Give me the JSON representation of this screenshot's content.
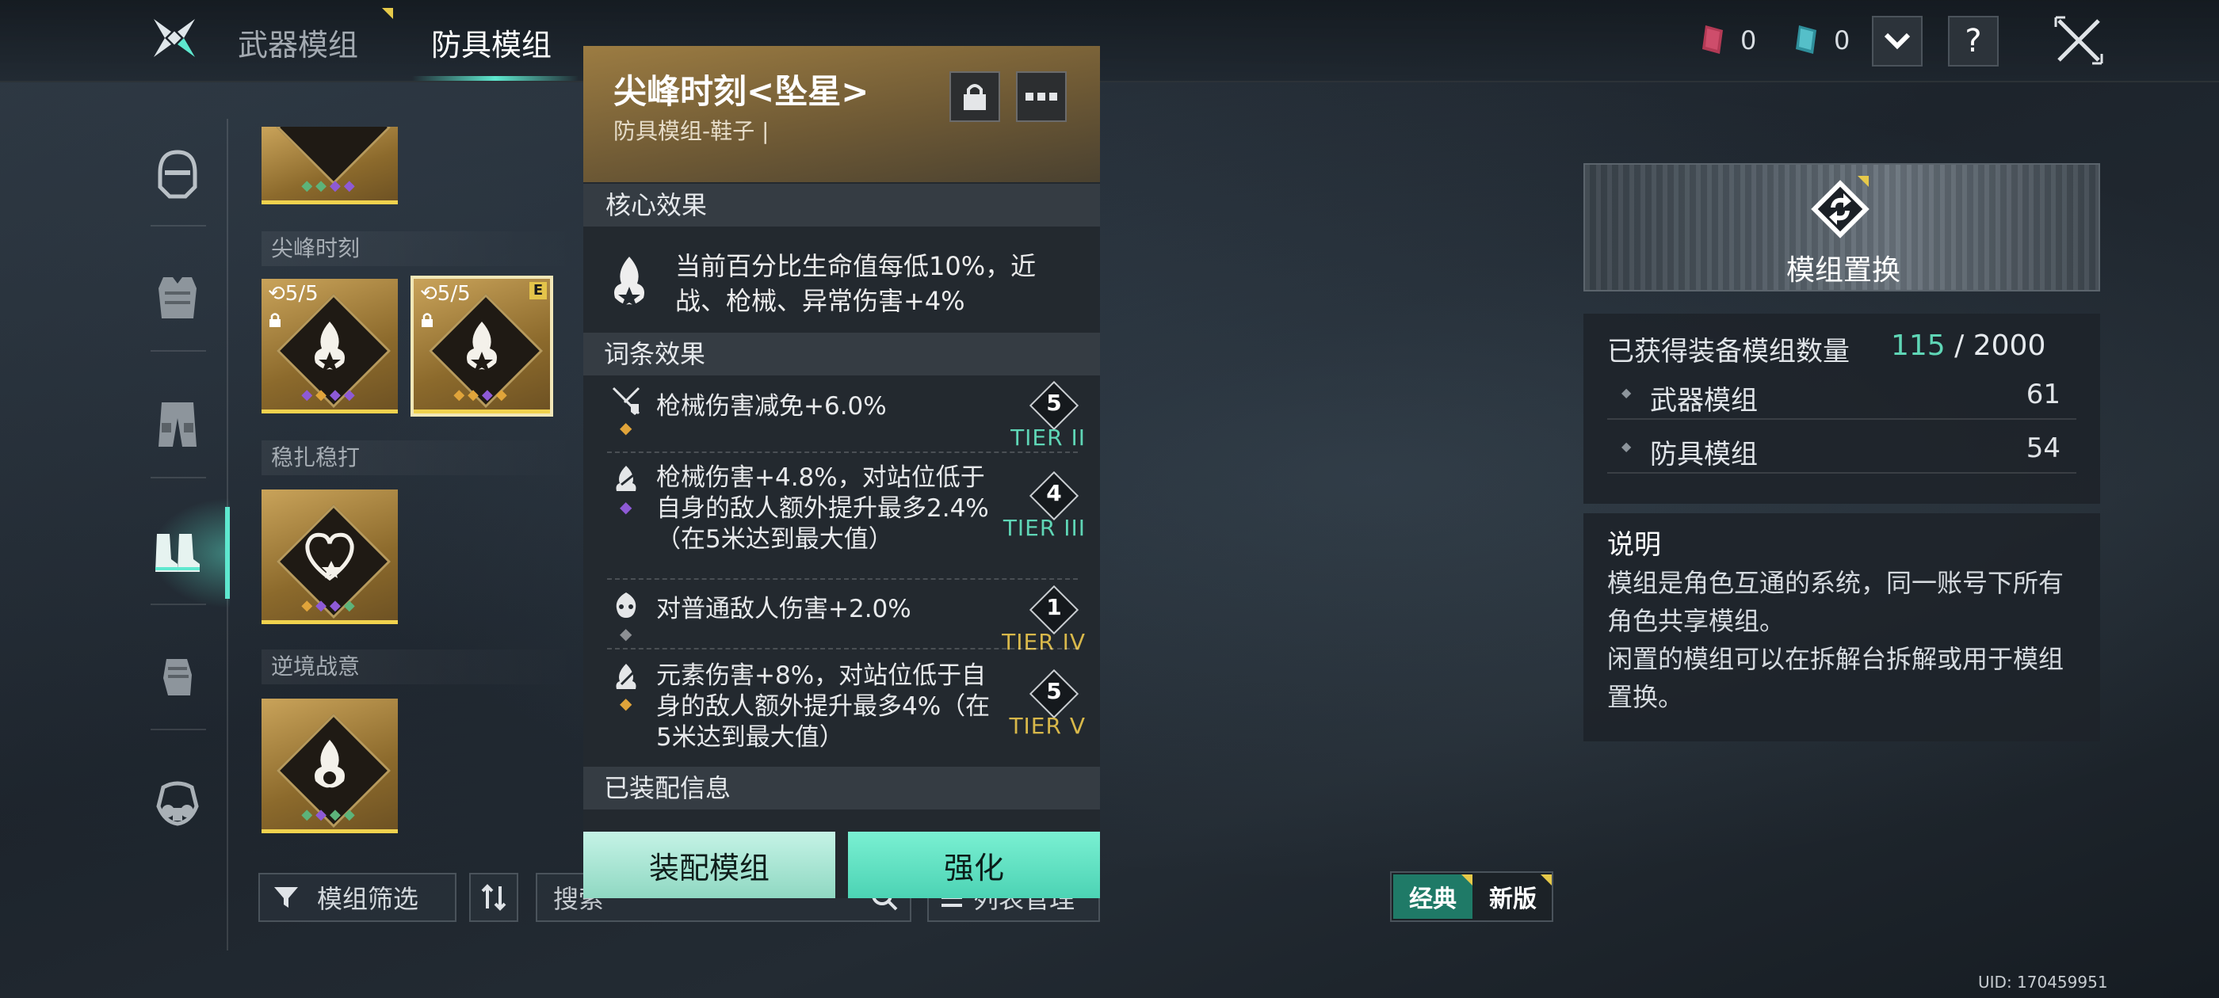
{
  "tabs": [
    {
      "label": "武器模组",
      "active": false
    },
    {
      "label": "防具模组",
      "active": true
    }
  ],
  "topbar": {
    "currency_a": {
      "icon": "red-crystal-icon",
      "value": "0"
    },
    "currency_b": {
      "icon": "teal-crystal-icon",
      "value": "0"
    },
    "dropdown_icon": "chevron-down-icon",
    "help_label": "?",
    "close_icon": "close-icon"
  },
  "nav": [
    "helmet-icon",
    "armor-vest-icon",
    "pants-icon",
    "boots-icon",
    "gloves-icon",
    "gas-mask-icon"
  ],
  "modules": {
    "sections": [
      {
        "title": "尖峰时刻"
      },
      {
        "title": "稳扎稳打"
      },
      {
        "title": "逆境战意"
      }
    ],
    "card_counts": [
      "5/5",
      "5/5"
    ],
    "equipped_badge": "E"
  },
  "bottom": {
    "filter_label": "模组筛选",
    "search_placeholder": "搜索",
    "list_label": "列表管理",
    "style_classic": "经典",
    "style_new": "新版"
  },
  "detail": {
    "title": "尖峰时刻<坠星>",
    "subtitle": "防具模组-鞋子 |",
    "core_header": "核心效果",
    "core_text": "当前百分比生命值每低10%，近战、枪械、异常伤害+4%",
    "affix_header": "词条效果",
    "affixes": [
      {
        "text": "枪械伤害减免+6.0%",
        "level": "5",
        "tier": "TIER II",
        "tier_color": "#5fd6b6",
        "gem_color": "#e0a43a"
      },
      {
        "text": "枪械伤害+4.8%，对站位低于自身的敌人额外提升最多2.4%（在5米达到最大值）",
        "level": "4",
        "tier": "TIER III",
        "tier_color": "#5fd6b6",
        "gem_color": "#8e5ad6"
      },
      {
        "text": "对普通敌人伤害+2.0%",
        "level": "1",
        "tier": "TIER IV",
        "tier_color": "#d8b84a",
        "gem_color": "#8c8f93"
      },
      {
        "text": "元素伤害+8%，对站位低于自身的敌人额外提升最多4%（在5米达到最大值）",
        "level": "5",
        "tier": "TIER V",
        "tier_color": "#d8b84a",
        "gem_color": "#e0a43a"
      }
    ],
    "equipped_header": "已装配信息",
    "equip_button": "装配模组",
    "enhance_button": "强化"
  },
  "right": {
    "replace_label": "模组置换",
    "owned_label": "已获得装备模组数量",
    "owned_count": "115",
    "owned_max": "/ 2000",
    "rows": [
      {
        "label": "武器模组",
        "value": "61"
      },
      {
        "label": "防具模组",
        "value": "54"
      }
    ],
    "desc_title": "说明",
    "desc_lines": [
      "模组是角色互通的系统，同一账号下所有角色共享模组。",
      "闲置的模组可以在拆解台拆解或用于模组置换。"
    ]
  },
  "uid": "UID: 170459951",
  "colors": {
    "accent": "#5ee8cf",
    "gold": "#c9a35a",
    "owned_count": "#5fd6b6"
  }
}
